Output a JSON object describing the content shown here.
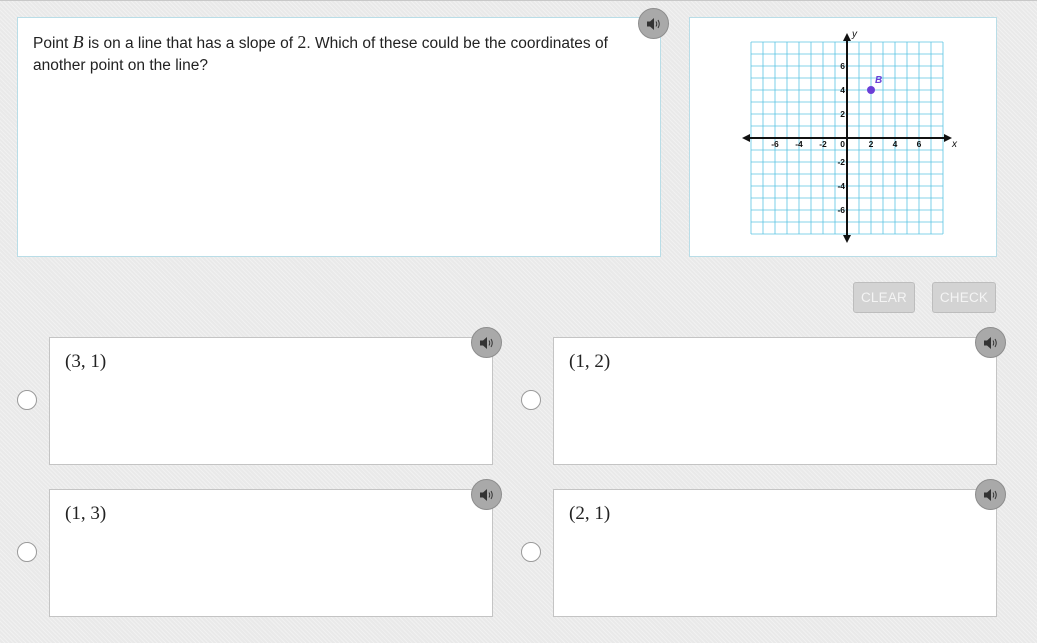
{
  "question": {
    "text_part1": "Point ",
    "point_var": "B",
    "text_part2": " is on a line that has a slope of ",
    "slope": "2",
    "text_part3": ". Which of these could be the coordinates of another point on the line?"
  },
  "graph": {
    "axis_x_label": "x",
    "axis_y_label": "y",
    "x_ticks": [
      -6,
      -4,
      -2,
      2,
      4,
      6
    ],
    "y_ticks": [
      6,
      4,
      2,
      -2,
      -4,
      -6
    ],
    "origin_label": "0",
    "range": [
      -8,
      8
    ],
    "point": {
      "label": "B",
      "x": 2,
      "y": 4,
      "color": "#6a3fd6"
    },
    "grid_color": "#5bc4e3"
  },
  "buttons": {
    "clear": "CLEAR",
    "check": "CHECK"
  },
  "choices": [
    {
      "label": "(3, 1)"
    },
    {
      "label": "(1, 2)"
    },
    {
      "label": "(1, 3)"
    },
    {
      "label": "(2, 1)"
    }
  ]
}
